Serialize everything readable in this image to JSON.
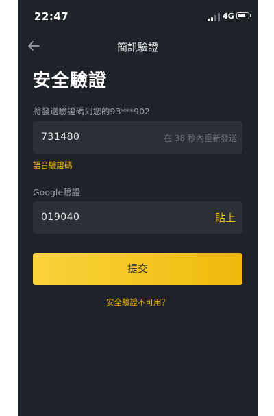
{
  "status_bar": {
    "time": "22:47",
    "network": "4G"
  },
  "nav": {
    "title": "簡訊驗證"
  },
  "page": {
    "heading": "安全驗證"
  },
  "sms": {
    "label": "將發送驗證碼到您的93***902",
    "code_value": "731480",
    "resend_text": "在 38 秒內重新發送",
    "voice_link": "語音驗證碼"
  },
  "google": {
    "label": "Google驗證",
    "code_value": "019040",
    "paste_label": "貼上"
  },
  "actions": {
    "submit_label": "提交",
    "unavailable_link": "安全驗證不可用？"
  },
  "colors": {
    "accent": "#f0b90b",
    "background": "#1f2229",
    "field": "#2b2f36"
  },
  "icons": {
    "back": "arrow-left-icon",
    "signal": "signal-icon",
    "battery": "battery-icon"
  }
}
